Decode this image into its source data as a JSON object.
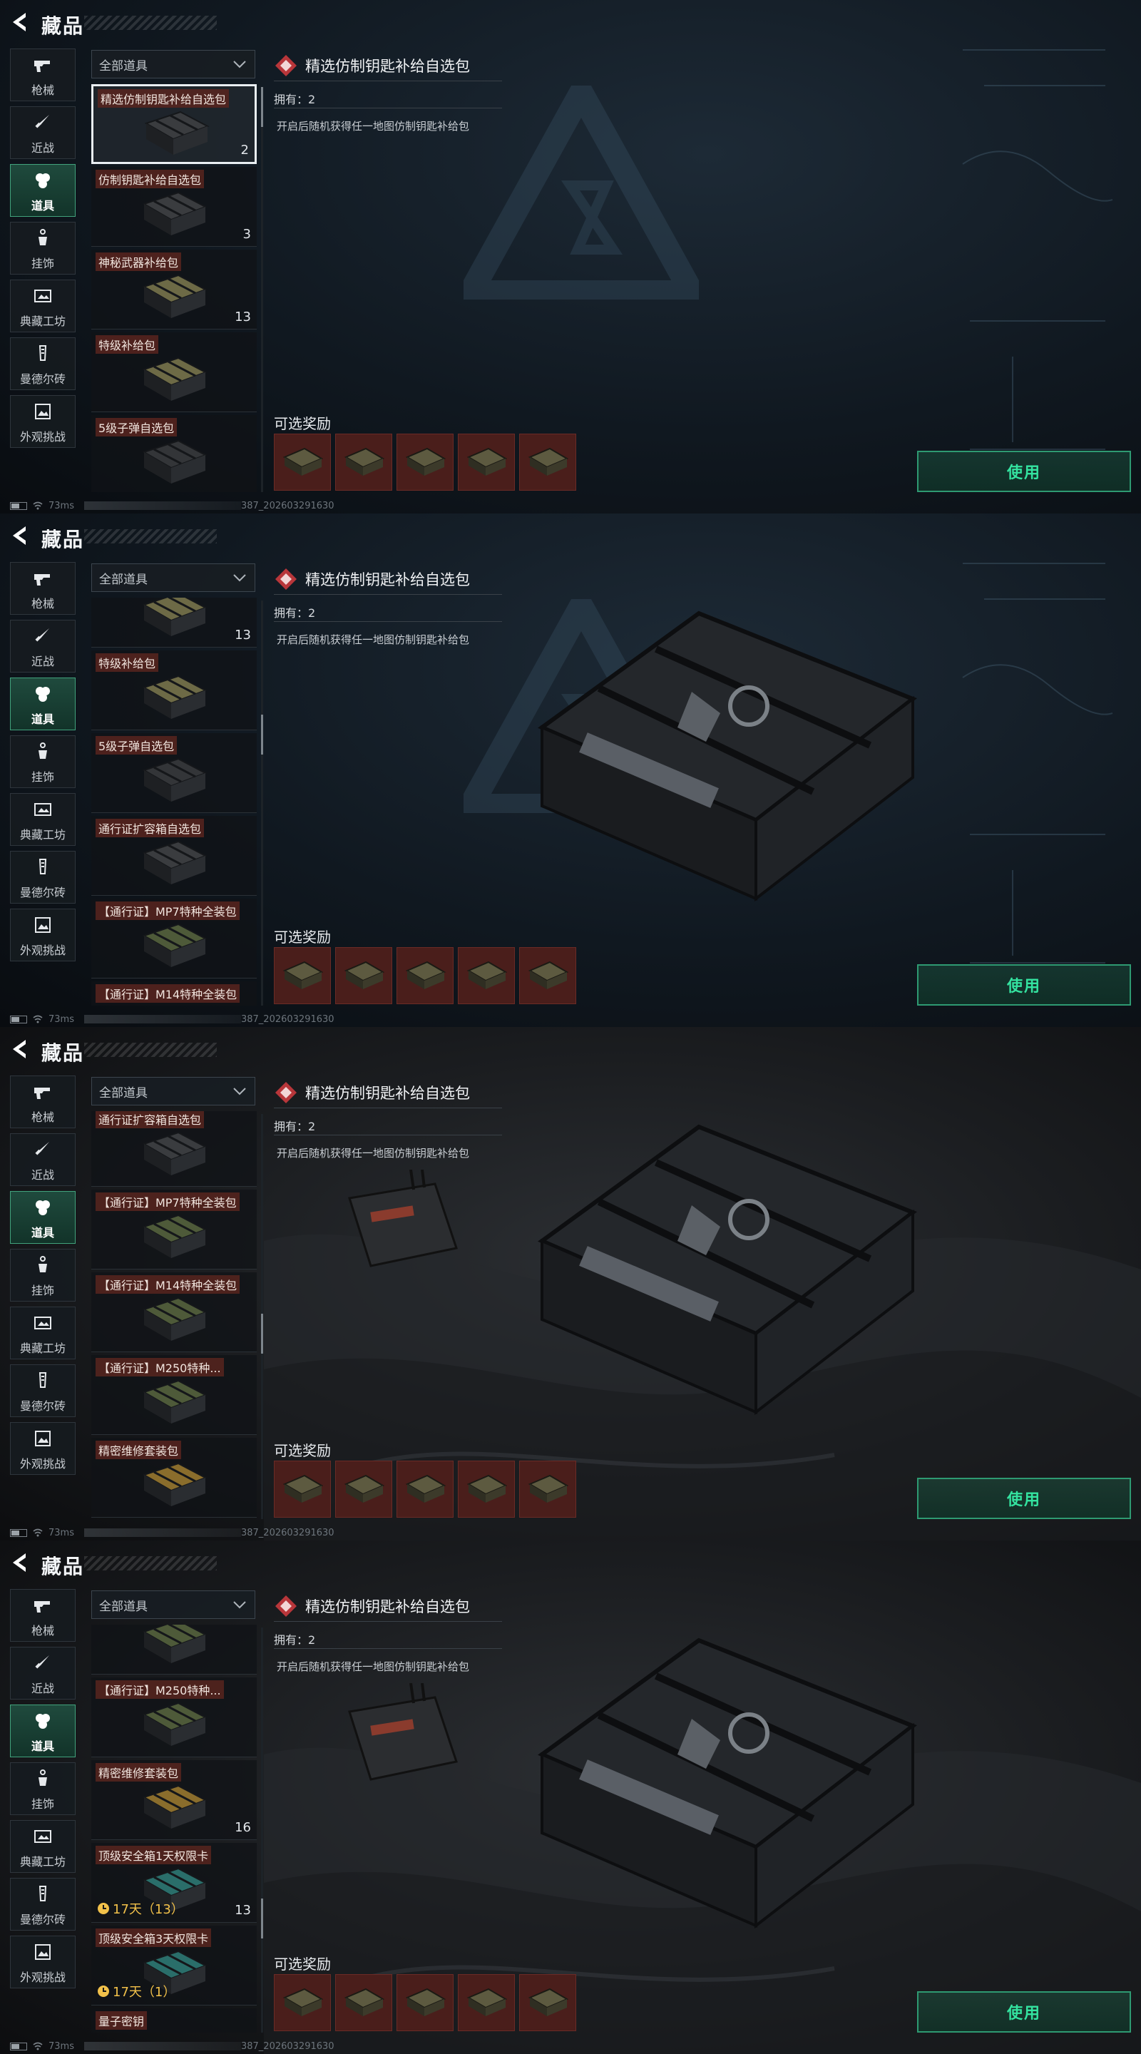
{
  "app": {
    "title": "藏品"
  },
  "sidebar": {
    "items": [
      {
        "label": "枪械",
        "icon": "gun-icon"
      },
      {
        "label": "近战",
        "icon": "knife-icon"
      },
      {
        "label": "道具",
        "icon": "grenade-icon",
        "active": true
      },
      {
        "label": "挂饰",
        "icon": "charm-icon"
      },
      {
        "label": "典藏工坊",
        "icon": "workshop-icon"
      },
      {
        "label": "曼德尔砖",
        "icon": "brick-icon"
      },
      {
        "label": "外观挑战",
        "icon": "challenge-icon"
      }
    ]
  },
  "filter": {
    "label": "全部道具"
  },
  "detail": {
    "title": "精选仿制钥匙补给自选包",
    "owned": "拥有：2",
    "description": "开启后随机获得任一地图仿制钥匙补给包",
    "rewards_title": "可选奖励",
    "reward_count": 5,
    "use_button": "使用"
  },
  "status": {
    "ping": "73ms",
    "build": "387_202603291630"
  },
  "frames": [
    {
      "items": [
        {
          "label": "精选仿制钥匙补给自选包",
          "count": "2",
          "selected": true,
          "color": "#3a3c3f"
        },
        {
          "label": "仿制钥匙补给自选包",
          "count": "3",
          "color": "#3a3c3f"
        },
        {
          "label": "神秘武器补给包",
          "count": "13",
          "color": "#6d6a46"
        },
        {
          "label": "特级补给包",
          "count": "",
          "color": "#6d6a46"
        },
        {
          "label": "5级子弹自选包",
          "count": "",
          "color": "#333538"
        }
      ]
    },
    {
      "items": [
        {
          "label": "",
          "count": "13",
          "color": "#6d6a46"
        },
        {
          "label": "特级补给包",
          "count": "",
          "color": "#6d6a46"
        },
        {
          "label": "5级子弹自选包",
          "count": "",
          "color": "#333538"
        },
        {
          "label": "通行证扩容箱自选包",
          "count": "",
          "color": "#3a3c3f"
        },
        {
          "label": "【通行证】MP7特种全装包",
          "count": "",
          "color": "#4e5a39"
        },
        {
          "label": "【通行证】M14特种全装包",
          "count": "",
          "color": "#4e5a39"
        }
      ]
    },
    {
      "items": [
        {
          "label": "通行证扩容箱自选包",
          "count": "",
          "color": "#3a3c3f"
        },
        {
          "label": "【通行证】MP7特种全装包",
          "count": "",
          "color": "#4e5a39"
        },
        {
          "label": "【通行证】M14特种全装包",
          "count": "",
          "color": "#4e5a39"
        },
        {
          "label": "【通行证】M250特种...",
          "count": "",
          "color": "#4e5a39"
        },
        {
          "label": "精密维修套装包",
          "count": "",
          "color": "#8a6d2c"
        }
      ]
    },
    {
      "items": [
        {
          "label": "",
          "count": "",
          "color": "#4e5a39"
        },
        {
          "label": "【通行证】M250特种...",
          "count": "",
          "color": "#4e5a39"
        },
        {
          "label": "精密维修套装包",
          "count": "16",
          "color": "#8a6d2c"
        },
        {
          "label": "顶级安全箱1天权限卡",
          "count": "13",
          "timer": "17天（13）",
          "color": "#2a6e6a"
        },
        {
          "label": "顶级安全箱3天权限卡",
          "count": "",
          "timer": "17天（1）",
          "color": "#2a6e6a"
        },
        {
          "label": "量子密钥",
          "count": "",
          "color": "#333538"
        }
      ]
    }
  ]
}
